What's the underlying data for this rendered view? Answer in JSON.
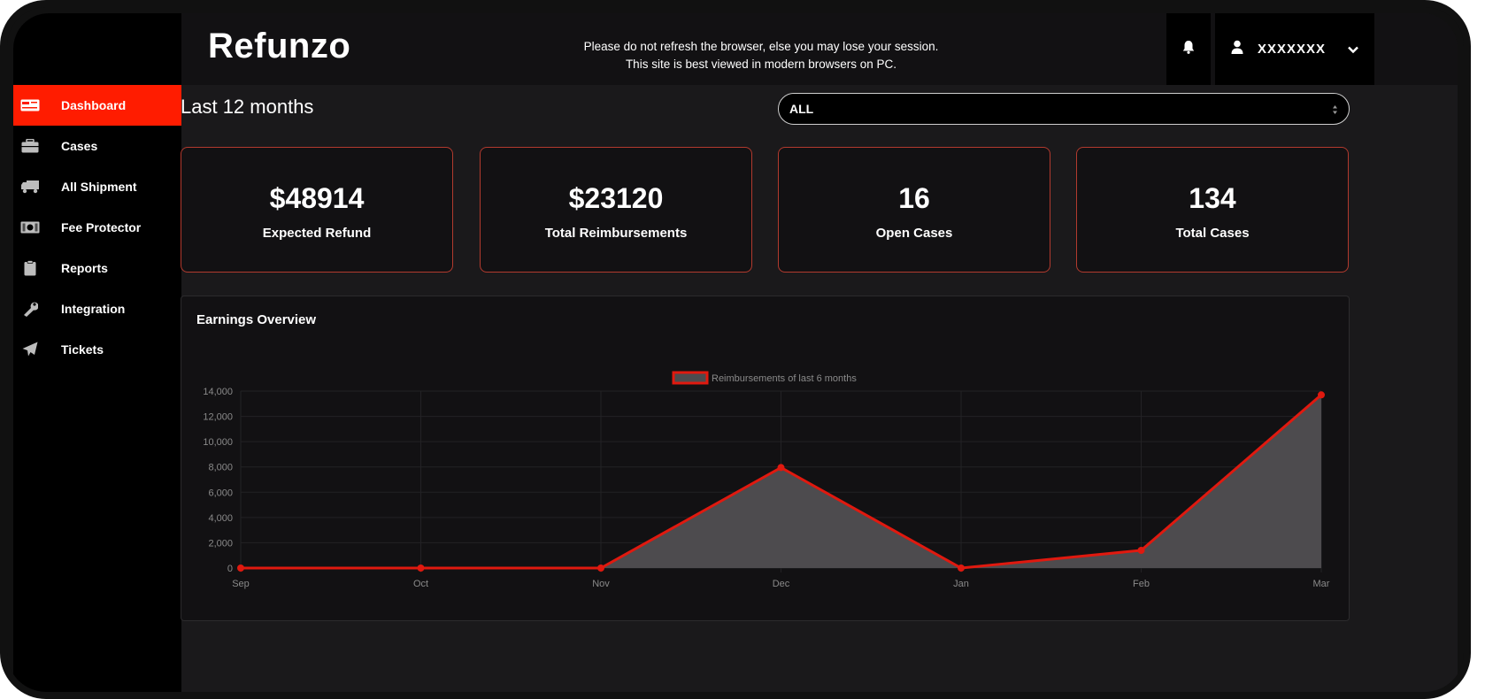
{
  "app": {
    "logo": "Refunzo",
    "notice_line1": "Please do not refresh the browser, else you may lose your session.",
    "notice_line2": "This site is best viewed in modern browsers on PC.",
    "user_name": "XXXXXXX",
    "accent_color": "#ff1c00"
  },
  "sidebar": {
    "items": [
      {
        "label": "Dashboard",
        "icon": "card-icon",
        "active": true
      },
      {
        "label": "Cases",
        "icon": "briefcase-icon",
        "active": false
      },
      {
        "label": "All Shipment",
        "icon": "truck-icon",
        "active": false
      },
      {
        "label": "Fee Protector",
        "icon": "money-icon",
        "active": false
      },
      {
        "label": "Reports",
        "icon": "clipboard-icon",
        "active": false
      },
      {
        "label": "Integration",
        "icon": "wrench-icon",
        "active": false
      },
      {
        "label": "Tickets",
        "icon": "paper-plane-icon",
        "active": false
      }
    ]
  },
  "main": {
    "period_title": "Last 12 months",
    "filter": {
      "selected": "ALL"
    },
    "stats": [
      {
        "value": "$48914",
        "label": "Expected Refund"
      },
      {
        "value": "$23120",
        "label": "Total Reimbursements"
      },
      {
        "value": "16",
        "label": "Open Cases"
      },
      {
        "value": "134",
        "label": "Total Cases"
      }
    ],
    "chart_title": "Earnings Overview"
  },
  "chart_data": {
    "type": "line",
    "title": "Earnings Overview",
    "x": [
      "Sep",
      "Oct",
      "Nov",
      "Dec",
      "Jan",
      "Feb",
      "Mar"
    ],
    "series": [
      {
        "name": "Reimbursements of last 6 months",
        "values": [
          0,
          0,
          0,
          7950,
          0,
          1400,
          13700
        ],
        "color": "#e0190f",
        "fill": "#4d4b4e"
      }
    ],
    "ylim": [
      0,
      14000
    ],
    "yticks": [
      "0",
      "2,000",
      "4,000",
      "6,000",
      "8,000",
      "10,000",
      "12,000",
      "14,000"
    ],
    "grid": true,
    "legend": "top-center"
  }
}
